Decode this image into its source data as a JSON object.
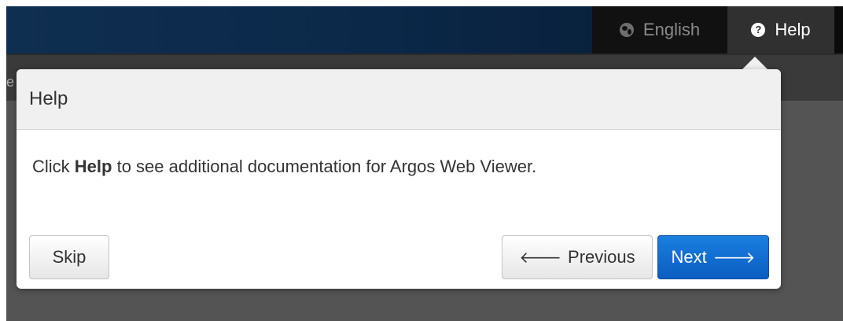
{
  "navbar": {
    "language_label": "English",
    "language_icon": "globe-icon",
    "help_label": "Help",
    "help_icon": "question-circle-icon",
    "background_color": "#0b2848"
  },
  "subbar": {
    "edge_text": "e"
  },
  "popover": {
    "title": "Help",
    "body_prefix": "Click ",
    "body_bold": "Help",
    "body_suffix": " to see additional documentation for Argos Web Viewer.",
    "buttons": {
      "skip_label": "Skip",
      "previous_label": "Previous",
      "previous_arrow": "🡐",
      "next_label": "Next",
      "next_arrow": "🡒",
      "next_color": "#0b5dc1"
    }
  }
}
